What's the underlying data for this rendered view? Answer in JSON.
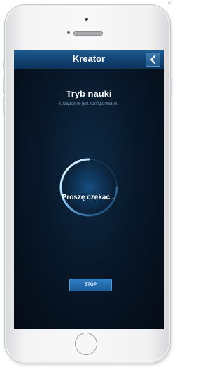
{
  "nav": {
    "title": "Kreator",
    "back_icon": "chevron-left-icon"
  },
  "main": {
    "heading": "Tryb nauki",
    "subheading": "Urządzenie jest konfigurowane.",
    "wait_text": "Proszę czekać...",
    "stop_label": "STOP"
  },
  "colors": {
    "accent": "#1b5f9e",
    "navbar": "#124272",
    "background": "#08182a"
  }
}
